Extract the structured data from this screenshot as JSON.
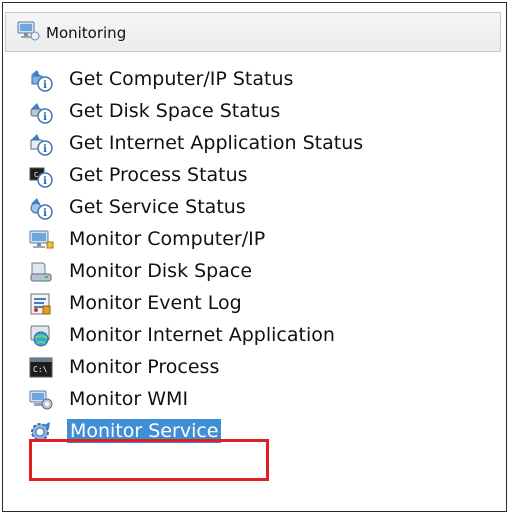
{
  "header": {
    "title": "Monitoring",
    "icon": "monitoring-computer-icon"
  },
  "items": [
    {
      "label": "Get Computer/IP Status",
      "icon": "info-computer-icon"
    },
    {
      "label": "Get Disk Space Status",
      "icon": "info-disk-icon"
    },
    {
      "label": "Get Internet Application Status",
      "icon": "info-web-icon"
    },
    {
      "label": "Get Process Status",
      "icon": "info-process-icon"
    },
    {
      "label": "Get Service Status",
      "icon": "info-service-icon"
    },
    {
      "label": "Monitor Computer/IP",
      "icon": "computer-icon"
    },
    {
      "label": "Monitor Disk Space",
      "icon": "disk-icon"
    },
    {
      "label": "Monitor Event Log",
      "icon": "event-log-icon"
    },
    {
      "label": "Monitor Internet Application",
      "icon": "globe-icon"
    },
    {
      "label": "Monitor Process",
      "icon": "process-icon"
    },
    {
      "label": "Monitor WMI",
      "icon": "wmi-icon"
    },
    {
      "label": "Monitor Service",
      "icon": "service-gear-icon",
      "selected": true
    }
  ],
  "colors": {
    "selection": "#3f8fd6",
    "highlight_box": "#e02020"
  }
}
